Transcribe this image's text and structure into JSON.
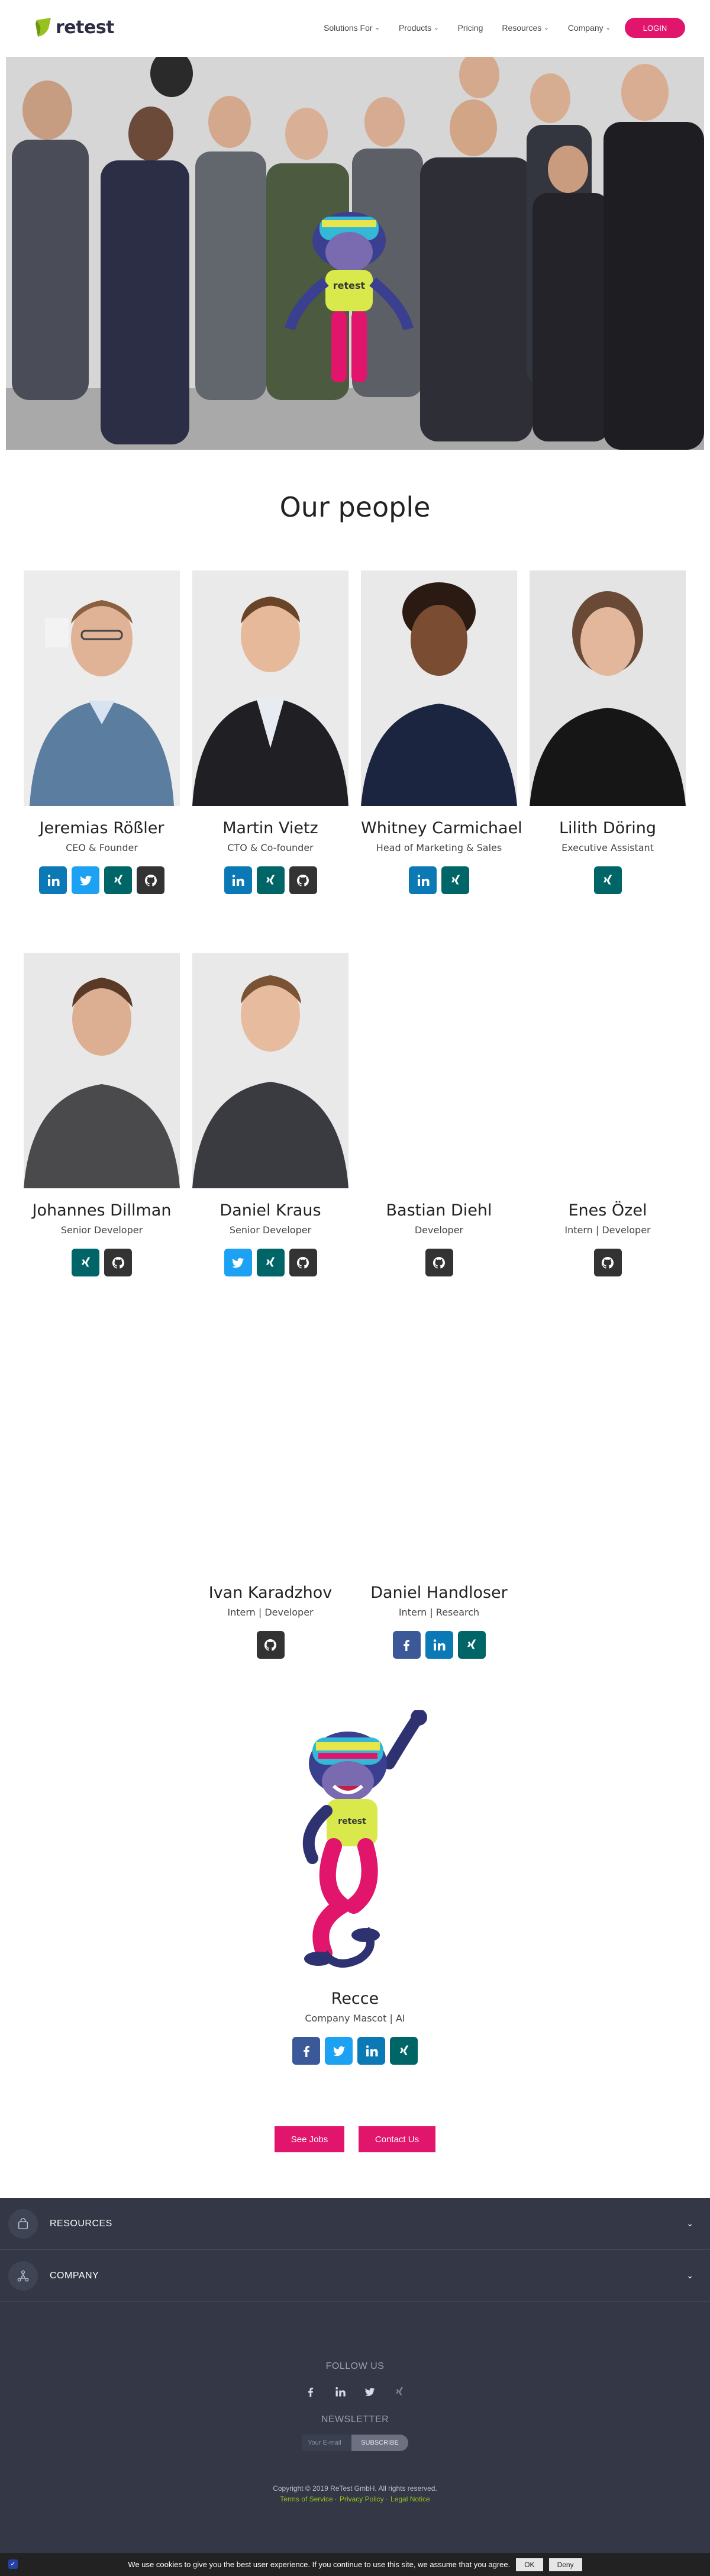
{
  "header": {
    "logo_text": "retest",
    "nav": [
      {
        "label": "Solutions For",
        "has_dropdown": true
      },
      {
        "label": "Products",
        "has_dropdown": true
      },
      {
        "label": "Pricing",
        "has_dropdown": false
      },
      {
        "label": "Resources",
        "has_dropdown": true
      },
      {
        "label": "Company",
        "has_dropdown": true
      }
    ],
    "login_label": "LOGIN",
    "accent_color": "#e0156b",
    "brand_green": "#96c11f"
  },
  "hero": {
    "mascot_shirt_text": "retest"
  },
  "page_title": "Our people",
  "team": [
    {
      "name": "Jeremias Rößler",
      "role": "CEO & Founder",
      "socials": [
        "linkedin-icon",
        "twitter-icon",
        "xing-icon",
        "github-icon"
      ]
    },
    {
      "name": "Martin Vietz",
      "role": "CTO & Co-founder",
      "socials": [
        "linkedin-icon",
        "xing-icon",
        "github-icon"
      ]
    },
    {
      "name": "Whitney Carmichael",
      "role": "Head of Marketing & Sales",
      "socials": [
        "linkedin-icon",
        "xing-icon"
      ]
    },
    {
      "name": "Lilith Döring",
      "role": "Executive Assistant",
      "socials": [
        "xing-icon"
      ]
    },
    {
      "name": "Johannes Dillman",
      "role": "Senior Developer",
      "socials": [
        "xing-icon",
        "github-icon"
      ]
    },
    {
      "name": "Daniel Kraus",
      "role": "Senior Developer",
      "socials": [
        "twitter-icon",
        "xing-icon",
        "github-icon"
      ]
    },
    {
      "name": "Bastian Diehl",
      "role": "Developer",
      "socials": [
        "github-icon"
      ]
    },
    {
      "name": "Enes Özel",
      "role": "Intern | Developer",
      "socials": [
        "github-icon"
      ]
    },
    {
      "name": "Ivan Karadzhov",
      "role": "Intern | Developer",
      "socials": [
        "github-icon"
      ]
    },
    {
      "name": "Daniel Handloser",
      "role": "Intern | Research",
      "socials": [
        "facebook-icon",
        "linkedin-icon",
        "xing-icon"
      ]
    }
  ],
  "mascot": {
    "name": "Recce",
    "role": "Company Mascot | AI",
    "socials": [
      "facebook-icon",
      "twitter-icon",
      "linkedin-icon",
      "xing-icon"
    ]
  },
  "buttons": {
    "see_jobs": "See Jobs",
    "contact_us": "Contact Us"
  },
  "footer": {
    "accordions": [
      {
        "label": "RESOURCES",
        "icon": "bag-icon"
      },
      {
        "label": "COMPANY",
        "icon": "network-icon"
      }
    ],
    "follow_heading": "FOLLOW US",
    "follow_icons": [
      "facebook-icon",
      "linkedin-icon",
      "twitter-icon",
      "xing-icon"
    ],
    "newsletter_heading": "NEWSLETTER",
    "newsletter_placeholder": "Your E-mail",
    "subscribe_label": "SUBSCRIBE",
    "copyright": "Copyright © 2019 ReTest GmbH. All rights reserved.",
    "links": [
      "Terms of Service",
      "Privacy Policy",
      "Legal Notice"
    ],
    "link_separator": "·"
  },
  "cookie_bar": {
    "text": "We use cookies to give you the best user experience. If you continue to use this site, we assume that you agree.",
    "ok_label": "OK",
    "deny_label": "Deny"
  }
}
